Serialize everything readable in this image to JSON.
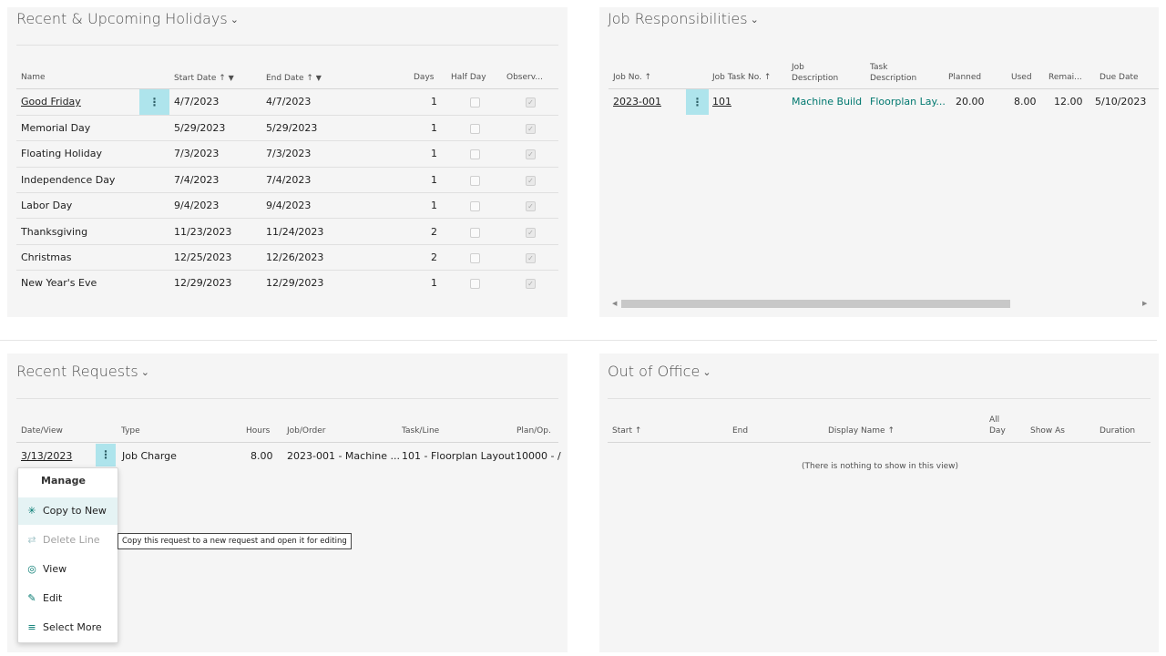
{
  "holidays": {
    "title": "Recent & Upcoming Holidays",
    "columns": [
      "Name",
      "Start Date ↑",
      "End Date ↑",
      "Days",
      "Half Day",
      "Observ..."
    ],
    "rows": [
      {
        "name": "Good Friday",
        "start": "4/7/2023",
        "end": "4/7/2023",
        "days": "1"
      },
      {
        "name": "Memorial Day",
        "start": "5/29/2023",
        "end": "5/29/2023",
        "days": "1"
      },
      {
        "name": "Floating Holiday",
        "start": "7/3/2023",
        "end": "7/3/2023",
        "days": "1"
      },
      {
        "name": "Independence Day",
        "start": "7/4/2023",
        "end": "7/4/2023",
        "days": "1"
      },
      {
        "name": "Labor Day",
        "start": "9/4/2023",
        "end": "9/4/2023",
        "days": "1"
      },
      {
        "name": "Thanksgiving",
        "start": "11/23/2023",
        "end": "11/24/2023",
        "days": "2"
      },
      {
        "name": "Christmas",
        "start": "12/25/2023",
        "end": "12/26/2023",
        "days": "2"
      },
      {
        "name": "New Year's Eve",
        "start": "12/29/2023",
        "end": "12/29/2023",
        "days": "1"
      }
    ]
  },
  "jobs": {
    "title": "Job Responsibilities",
    "columns": {
      "job_no": "Job No. ↑",
      "task_no": "Job Task No. ↑",
      "job_desc_1": "Job",
      "job_desc_2": "Description",
      "task_desc_1": "Task",
      "task_desc_2": "Description",
      "planned": "Planned",
      "used": "Used",
      "remaining": "Remai...",
      "due": "Due Date"
    },
    "row": {
      "job_no": "2023-001",
      "task_no": "101",
      "job_desc": "Machine Build",
      "task_desc": "Floorplan Lay...",
      "planned": "20.00",
      "used": "8.00",
      "remaining": "12.00",
      "due": "5/10/2023"
    }
  },
  "requests": {
    "title": "Recent Requests",
    "columns": [
      "Date/View",
      "Type",
      "Hours",
      "Job/Order",
      "Task/Line",
      "Plan/Op."
    ],
    "row": {
      "date": "3/13/2023",
      "type": "Job Charge",
      "hours": "8.00",
      "job": "2023-001 - Machine ...",
      "task": "101 - Floorplan Layout",
      "plan": "10000 - /"
    }
  },
  "out_of_office": {
    "title": "Out of Office",
    "columns": {
      "start": "Start ↑",
      "end": "End",
      "display_name": "Display Name ↑",
      "all_day_1": "All",
      "all_day_2": "Day",
      "show_as": "Show As",
      "duration": "Duration"
    },
    "empty_text": "(There is nothing to show in this view)"
  },
  "context_menu": {
    "header": "Manage",
    "items": [
      {
        "label": "Copy to New",
        "icon": "copy-to-new-icon"
      },
      {
        "label": "Delete Line",
        "icon": "delete-line-icon"
      },
      {
        "label": "View",
        "icon": "view-icon"
      },
      {
        "label": "Edit",
        "icon": "edit-icon"
      },
      {
        "label": "Select More",
        "icon": "select-more-icon"
      }
    ]
  },
  "tooltip": "Copy this request to a new request and open it for editing"
}
